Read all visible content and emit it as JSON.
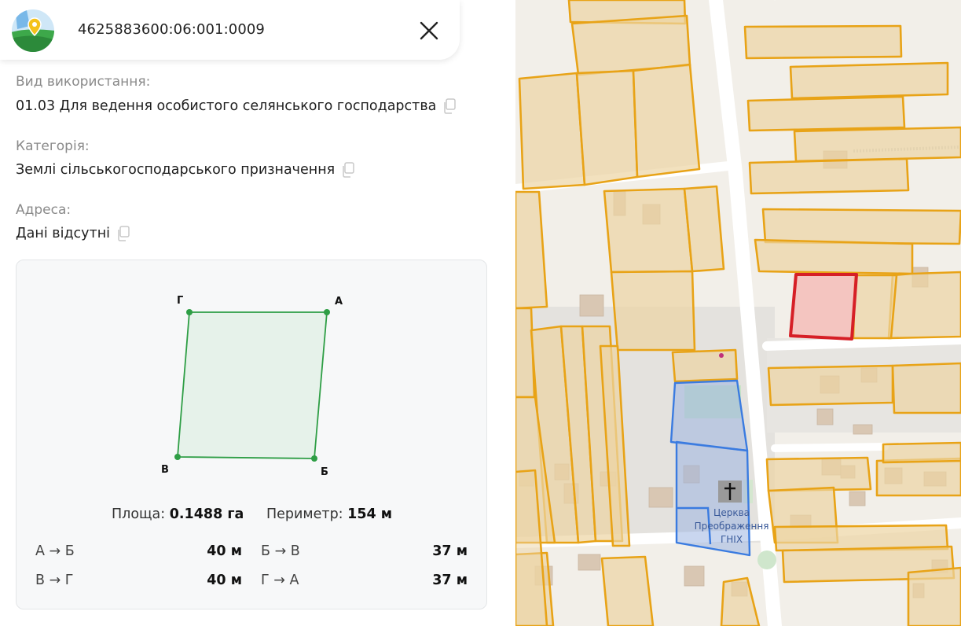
{
  "header": {
    "cadastral_number": "4625883600:06:001:0009",
    "logo_icon": "map-pin-logo-icon",
    "close_icon": "close-icon"
  },
  "fields": [
    {
      "label": "Вид використання:",
      "value": "01.03 Для ведення особистого селянського господарства"
    },
    {
      "label": "Категорія:",
      "value": "Землі сільськогосподарського призначення"
    },
    {
      "label": "Адреса:",
      "value": "Дані відсутні"
    }
  ],
  "plot": {
    "vertices": {
      "a": "А",
      "b": "Б",
      "v": "В",
      "g": "Г"
    },
    "area_label": "Площа:",
    "area_value": "0.1488 га",
    "perimeter_label": "Периметр:",
    "perimeter_value": "154 м",
    "sides": [
      {
        "label": "А → Б",
        "length": "40 м"
      },
      {
        "label": "Б → В",
        "length": "37 м"
      },
      {
        "label": "В → Г",
        "length": "40 м"
      },
      {
        "label": "Г → А",
        "length": "37 м"
      }
    ],
    "fill_color": "#e6f2ea",
    "stroke_color": "#2e9e45"
  },
  "map": {
    "poi_label_line1": "Церква",
    "poi_label_line2": "Преображення",
    "poi_label_line3": "ГНІХ",
    "poi_icon": "church-cross-icon",
    "parcel_color": "#e8a317",
    "selected_color": "#d61f26",
    "blue_color": "#3a7be0"
  }
}
